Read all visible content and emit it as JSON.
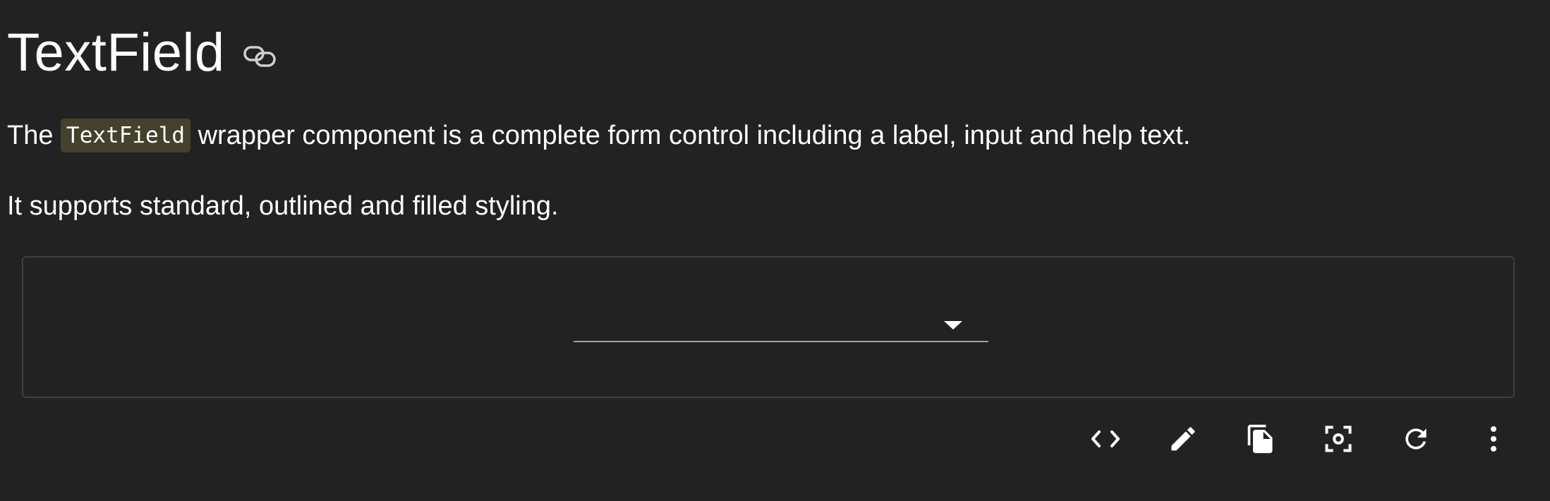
{
  "heading": {
    "title": "TextField",
    "link_icon": "link-icon"
  },
  "description": {
    "prefix": "The ",
    "code": "TextField",
    "suffix": " wrapper component is a complete form control including a label, input and help text.",
    "line2": "It supports standard, outlined and filled styling."
  },
  "demo": {
    "select_value": "",
    "dropdown_icon": "arrow-drop-down-icon"
  },
  "toolbar": {
    "icons": [
      "code-icon",
      "edit-icon",
      "copy-icon",
      "screenshot-icon",
      "reset-icon",
      "more-vert-icon"
    ]
  },
  "colors": {
    "background": "#222222",
    "text": "#ffffff",
    "code_bg": "#44412c",
    "border": "#3f3f3f",
    "underline": "#9e9e9e"
  }
}
